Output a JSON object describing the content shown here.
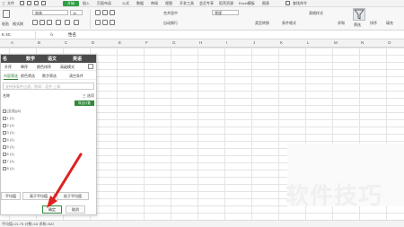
{
  "titlebar": {
    "menus": [
      "三",
      "文件",
      "开始",
      "插入",
      "页面布局",
      "公式",
      "数据",
      "审阅",
      "视图",
      "开发工具",
      "会员专享",
      "稻壳资源",
      "Excel模板",
      "图表",
      "查找命令"
    ],
    "start_label": "开始"
  },
  "ribbon": {
    "font_name": "宋体",
    "font_size": "11",
    "groups": [
      "合并居中",
      "自动换行",
      "常规",
      "类型转换",
      "条件格式",
      "表格样式",
      "求和",
      "筛选",
      "排序",
      "填充",
      "单元格",
      "行和列"
    ],
    "brush_label": "格式刷",
    "paste_label": "粘贴"
  },
  "formula_bar": {
    "cell_ref": "K 4C",
    "fx": "fx",
    "value": "性名"
  },
  "columns": [
    "A",
    "B",
    "C",
    "D",
    "E",
    "F",
    "G",
    "H",
    "I",
    "J",
    "K",
    "L",
    "M",
    "N",
    "O"
  ],
  "dialog": {
    "header": [
      "名",
      "数学",
      "语文",
      "英语"
    ],
    "tools": [
      "升序",
      "降序",
      "颜色排序",
      "高级模式"
    ],
    "tabs": [
      "内容筛选",
      "颜色筛选",
      "数字筛选",
      "清空条件"
    ],
    "search_placeholder": "支持多条件过滤，例如：北京 上海",
    "list_header": "名称",
    "export_label": "三 选项",
    "export_tag": "导出计数",
    "rows": [
      "(全选)(6)",
      "1 (1)",
      "2 (1)",
      "3 (1)",
      "4 (1)",
      "5 (1)",
      "6 (1)",
      "7 (1)",
      "8 (1)"
    ],
    "bottom_buttons": [
      "平均值",
      "高于平均值",
      "低于平均值"
    ],
    "ok": "确定",
    "cancel": "取消"
  },
  "statusbar": {
    "text": "平均值=21.75 计数=16 求和=522"
  },
  "watermark": "软件技巧",
  "colors": {
    "accent": "#2f9e44",
    "arrow": "#e02020",
    "header_dark": "#4b4b4b"
  }
}
